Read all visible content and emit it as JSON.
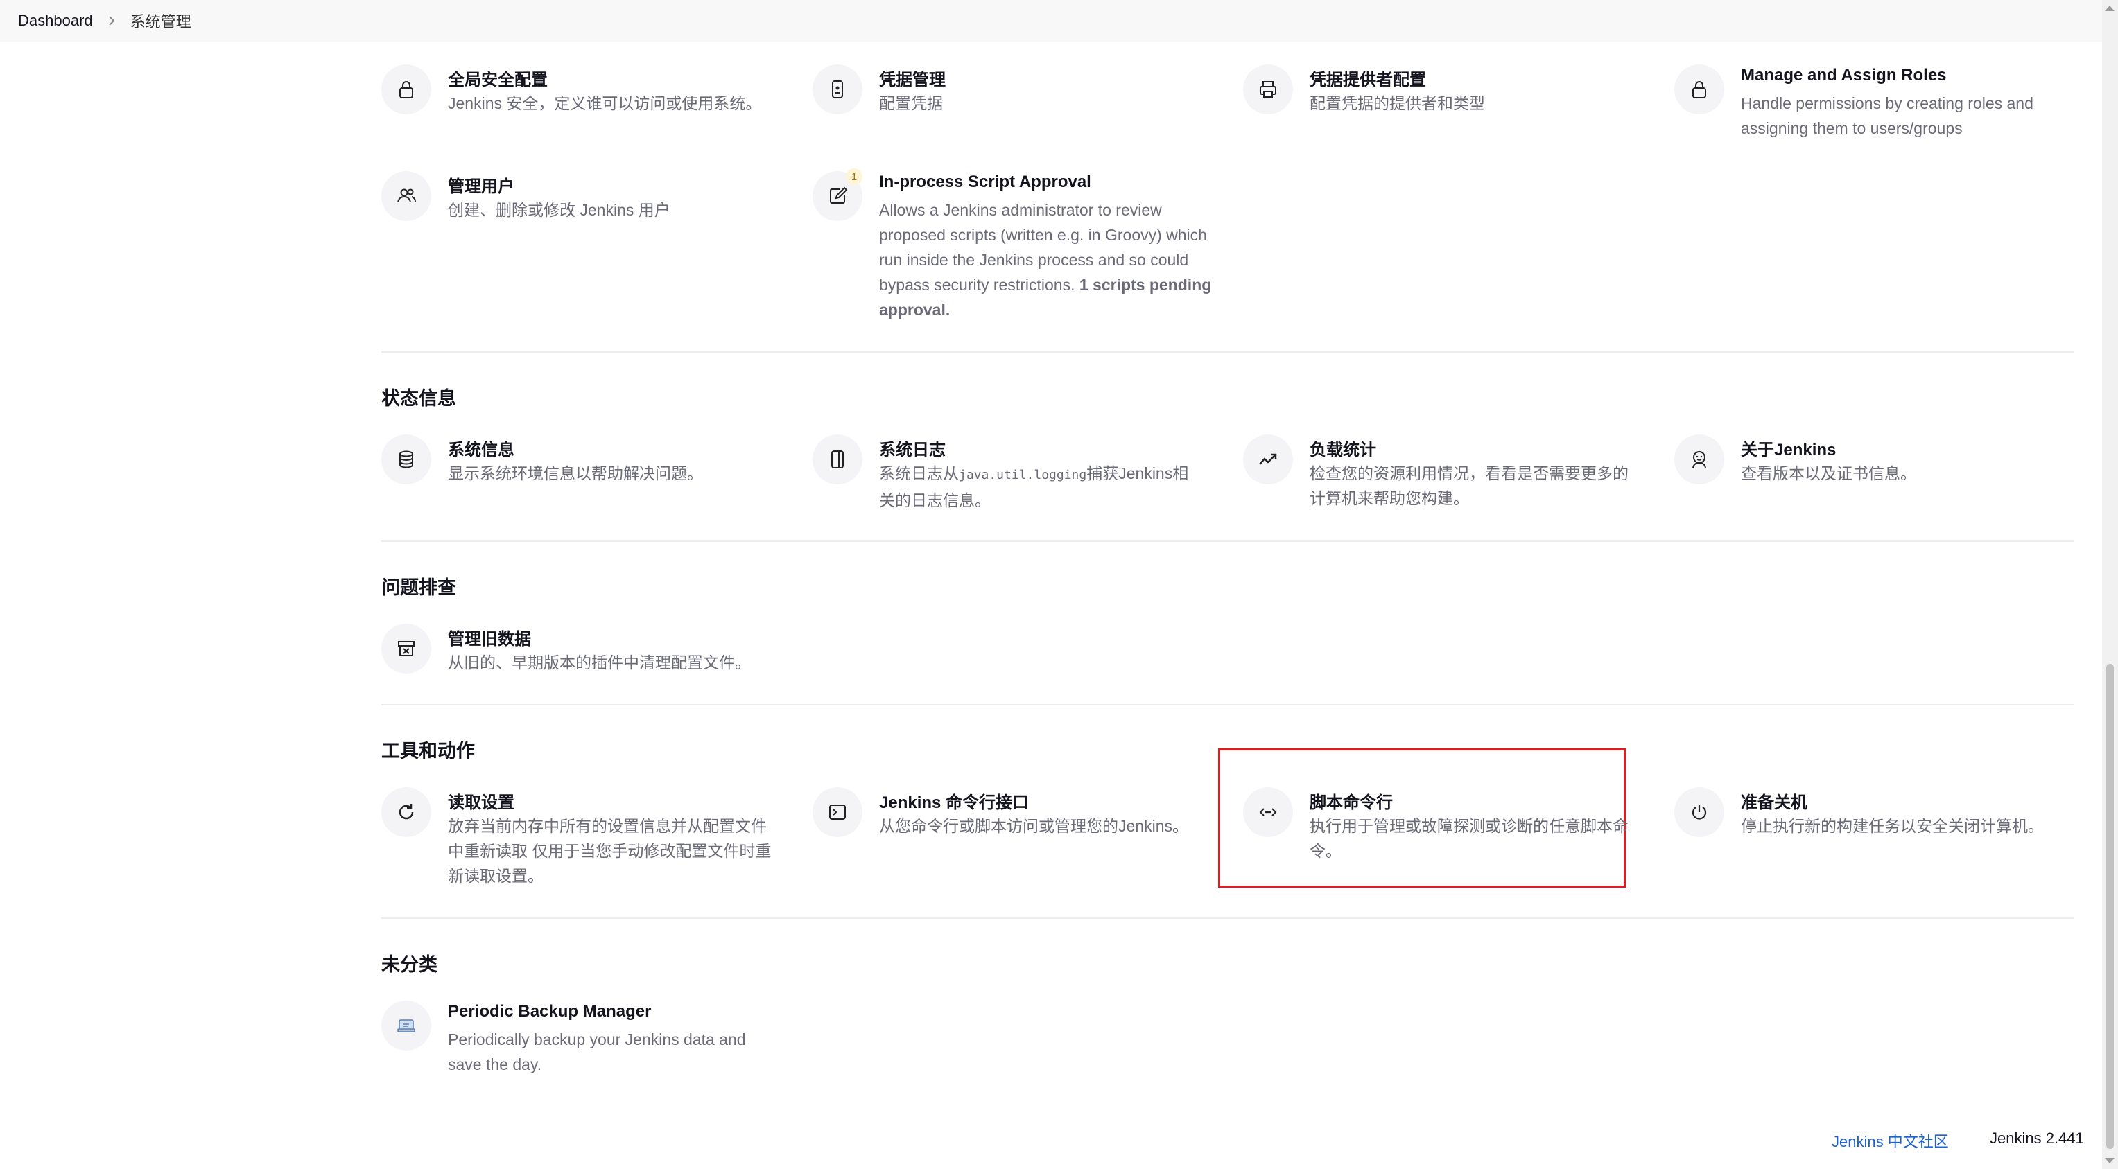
{
  "breadcrumb": {
    "home": "Dashboard",
    "current": "系统管理"
  },
  "security": {
    "items": [
      {
        "icon": "lock-icon",
        "title": "全局安全配置",
        "desc": "Jenkins 安全，定义谁可以访问或使用系统。"
      },
      {
        "icon": "credential-device-icon",
        "title": "凭据管理",
        "desc": "配置凭据"
      },
      {
        "icon": "printer-icon",
        "title": "凭据提供者配置",
        "desc": "配置凭据的提供者和类型"
      },
      {
        "icon": "lock-icon",
        "title": "Manage and Assign Roles",
        "desc": "Handle permissions by creating roles and assigning them to users/groups"
      },
      {
        "icon": "users-icon",
        "title": "管理用户",
        "desc": "创建、删除或修改 Jenkins 用户"
      },
      {
        "icon": "edit-icon",
        "title": "In-process Script Approval",
        "badge": "1",
        "desc": "Allows a Jenkins administrator to review proposed scripts (written e.g. in Groovy) which run inside the Jenkins process and so could bypass security restrictions.",
        "desc_bold": "1 scripts pending approval."
      }
    ]
  },
  "status": {
    "title": "状态信息",
    "items": [
      {
        "icon": "database-icon",
        "title": "系统信息",
        "desc": "显示系统环境信息以帮助解决问题。"
      },
      {
        "icon": "log-icon",
        "title": "系统日志",
        "desc_pre": "系统日志从",
        "desc_code": "java.util.logging",
        "desc_post": "捕获Jenkins相关的日志信息。"
      },
      {
        "icon": "trend-icon",
        "title": "负载统计",
        "desc": "检查您的资源利用情况，看看是否需要更多的计算机来帮助您构建。"
      },
      {
        "icon": "jenkins-butler-icon",
        "title": "关于Jenkins",
        "desc": "查看版本以及证书信息。"
      }
    ]
  },
  "troubleshooting": {
    "title": "问题排查",
    "items": [
      {
        "icon": "archive-icon",
        "title": "管理旧数据",
        "desc": "从旧的、早期版本的插件中清理配置文件。"
      }
    ]
  },
  "tools": {
    "title": "工具和动作",
    "items": [
      {
        "icon": "reload-icon",
        "title": "读取设置",
        "desc": "放弃当前内存中所有的设置信息并从配置文件中重新读取 仅用于当您手动修改配置文件时重新读取设置。"
      },
      {
        "icon": "terminal-icon",
        "title": "Jenkins 命令行接口",
        "desc": "从您命令行或脚本访问或管理您的Jenkins。"
      },
      {
        "icon": "code-icon",
        "title": "脚本命令行",
        "desc": "执行用于管理或故障探测或诊断的任意脚本命令。"
      },
      {
        "icon": "power-icon",
        "title": "准备关机",
        "desc": "停止执行新的构建任务以安全关闭计算机。"
      }
    ]
  },
  "uncategorized": {
    "title": "未分类",
    "items": [
      {
        "icon": "backup-icon",
        "title": "Periodic Backup Manager",
        "desc": "Periodically backup your Jenkins data and save the day."
      }
    ]
  },
  "footer": {
    "community_link": "Jenkins 中文社区",
    "version": "Jenkins 2.441"
  },
  "colors": {
    "highlight": "#e11b22",
    "link": "#1d63ce"
  }
}
